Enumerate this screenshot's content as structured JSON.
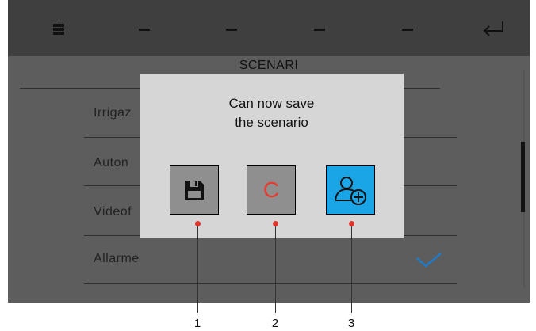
{
  "screen": {
    "title": "SCENARI",
    "rows": [
      {
        "label": "Irrigaz"
      },
      {
        "label": "Auton"
      },
      {
        "label": "Videof"
      },
      {
        "label": "Allarme"
      }
    ]
  },
  "topbar": {
    "icons": [
      "grid-icon",
      "minus-icon",
      "minus-icon",
      "minus-icon",
      "minus-icon",
      "return-arrow-icon"
    ]
  },
  "dialog": {
    "message_line1": "Can now save",
    "message_line2": "the scenario",
    "buttons": [
      {
        "icon": "floppy-disk-icon",
        "label": ""
      },
      {
        "icon": "",
        "label": "C"
      },
      {
        "icon": "user-add-icon",
        "label": ""
      }
    ]
  },
  "callouts": [
    "1",
    "2",
    "3"
  ],
  "colors": {
    "background": "#5d5d5d",
    "topbar": "#3f3f3f",
    "dialog": "#d6d6d6",
    "button_gray": "#8f8f8f",
    "button_blue": "#1aa5e6",
    "cancel_letter": "#e53a2f",
    "check": "#1f7bc8",
    "callout_dot": "#e0342b"
  }
}
